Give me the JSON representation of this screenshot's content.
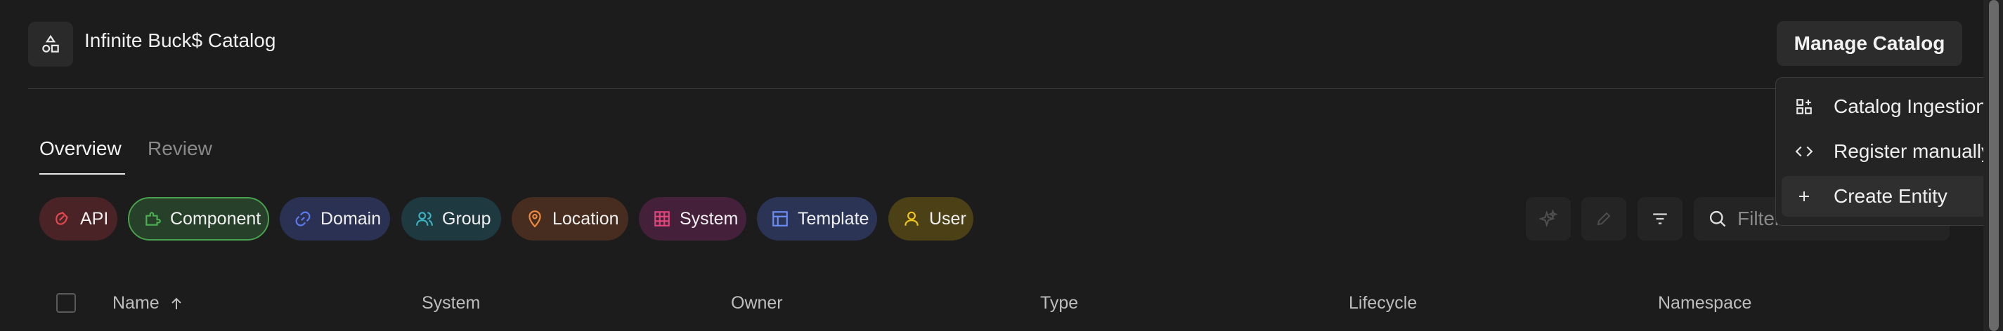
{
  "header": {
    "title": "Infinite Buck$ Catalog",
    "logo_icon": "shapes-icon",
    "manage_button_label": "Manage Catalog"
  },
  "tabs": [
    {
      "label": "Overview",
      "active": true
    },
    {
      "label": "Review",
      "active": false
    }
  ],
  "kind_chips": [
    {
      "label": "API",
      "icon": "api-icon",
      "color": "#e5484d",
      "selected": false
    },
    {
      "label": "Component",
      "icon": "puzzle-icon",
      "color": "#4caf50",
      "selected": true
    },
    {
      "label": "Domain",
      "icon": "link-icon",
      "color": "#5b7bf0",
      "selected": false
    },
    {
      "label": "Group",
      "icon": "users-icon",
      "color": "#3bb3c3",
      "selected": false
    },
    {
      "label": "Location",
      "icon": "map-pin-icon",
      "color": "#f08a3e",
      "selected": false
    },
    {
      "label": "System",
      "icon": "grid-icon",
      "color": "#e0457b",
      "selected": false
    },
    {
      "label": "Template",
      "icon": "layout-icon",
      "color": "#6a8cf5",
      "selected": false
    },
    {
      "label": "User",
      "icon": "user-icon",
      "color": "#f0c419",
      "selected": false
    }
  ],
  "toolbar": {
    "filter_placeholder": "Filter",
    "buttons": [
      "sparkles-icon",
      "pencil-icon",
      "filter-lines-icon"
    ]
  },
  "table": {
    "columns": [
      "Name",
      "System",
      "Owner",
      "Type",
      "Lifecycle",
      "Namespace"
    ],
    "sort_column": "Name",
    "sort_direction": "ascending"
  },
  "manage_menu": {
    "items": [
      {
        "label": "Catalog Ingestion",
        "icon": "ingestion-icon"
      },
      {
        "label": "Register manually",
        "icon": "code-icon"
      },
      {
        "label": "Create Entity",
        "icon": "plus-icon",
        "highlighted": true
      }
    ]
  }
}
